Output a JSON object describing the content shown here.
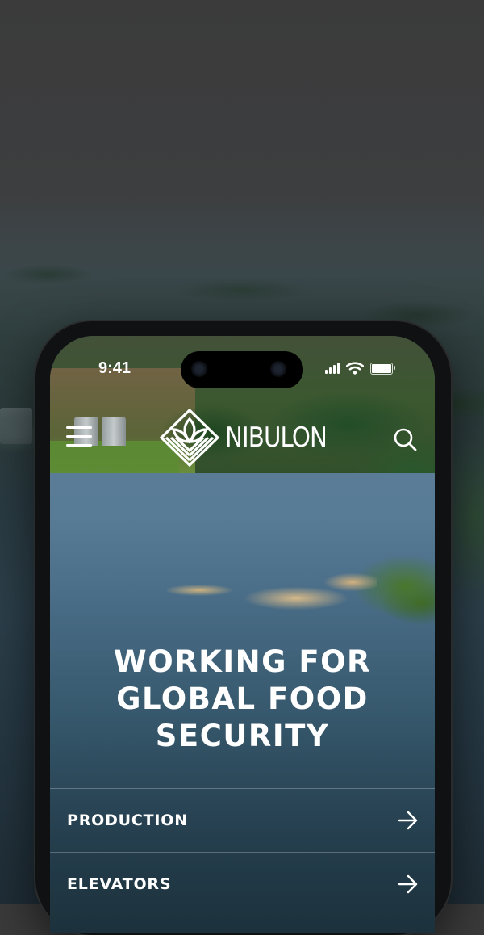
{
  "status_bar": {
    "time": "9:41"
  },
  "header": {
    "logo_text": "NIBULON",
    "menu_icon": "hamburger-menu-icon",
    "search_icon": "search-icon"
  },
  "hero": {
    "lines": [
      "WORKING FOR",
      "GLOBAL FOOD",
      "SECURITY"
    ]
  },
  "nav": {
    "items": [
      {
        "label": "PRODUCTION",
        "icon": "arrow-right-icon"
      },
      {
        "label": "ELEVATORS",
        "icon": "arrow-right-icon"
      }
    ]
  },
  "colors": {
    "text": "#ffffff",
    "phone_frame": "#101112",
    "background": "#3a3a3b"
  }
}
